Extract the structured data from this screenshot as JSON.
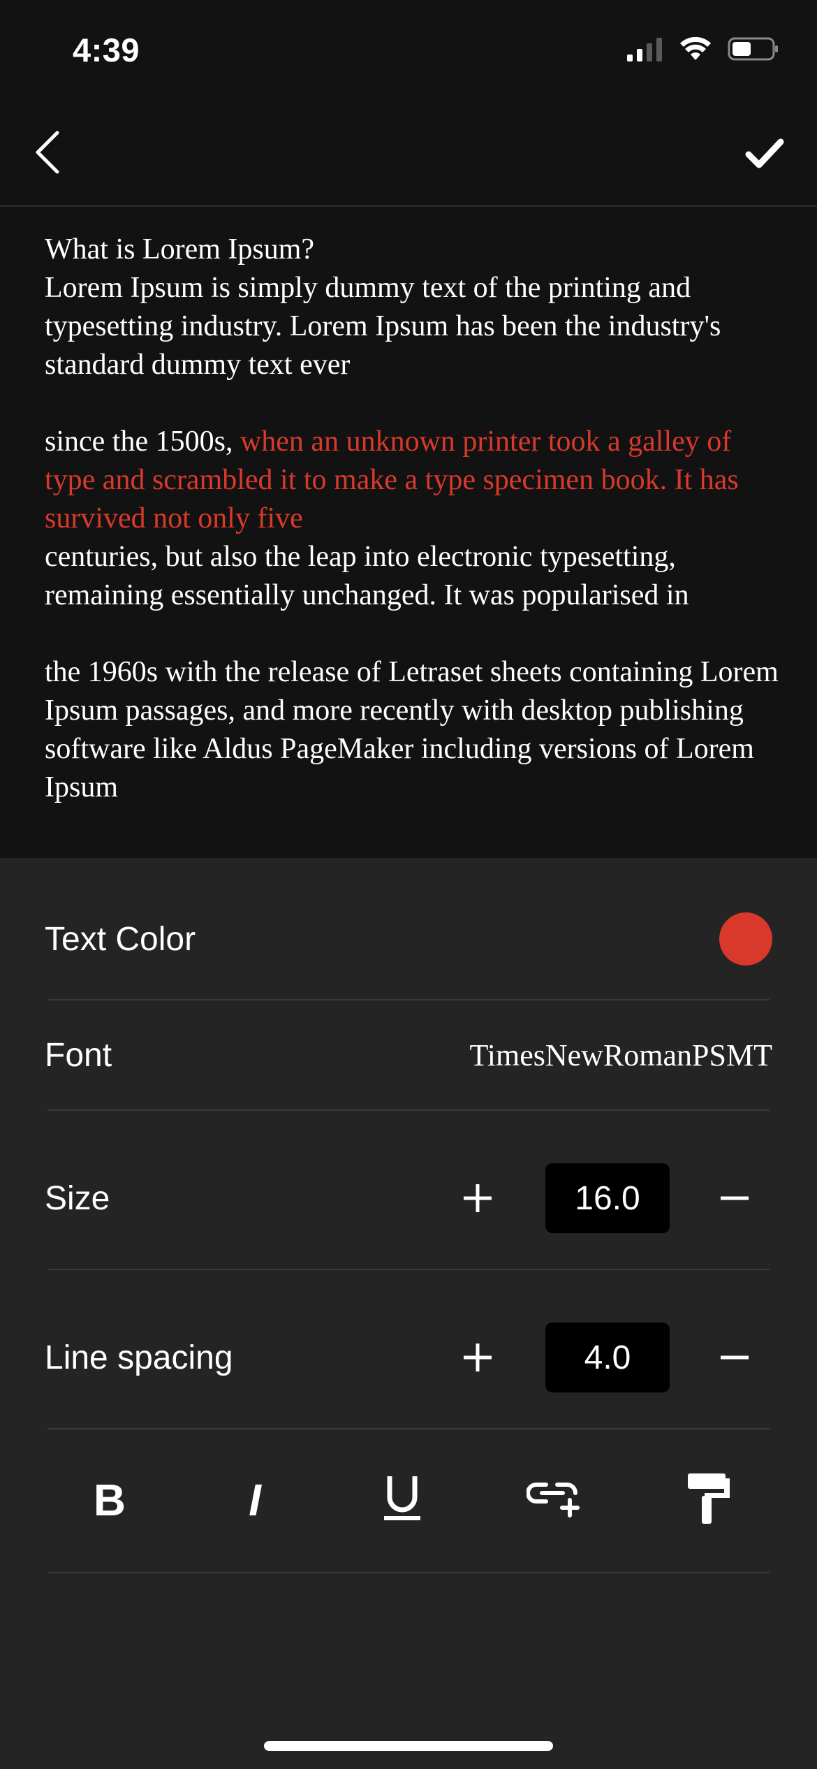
{
  "status_bar": {
    "time": "4:39"
  },
  "editor": {
    "paragraphs": [
      {
        "segments": [
          {
            "text": "What is Lorem Ipsum?\nLorem Ipsum is simply dummy text of the printing and typesetting industry. Lorem Ipsum has been the industry's standard dummy text ever",
            "color": "#ffffff"
          }
        ]
      },
      {
        "segments": [
          {
            "text": "since the 1500s, ",
            "color": "#ffffff"
          },
          {
            "text": "when an unknown printer took a galley of type and scrambled it to make a type specimen book. It has survived not only five",
            "color": "#d9392b"
          },
          {
            "text": "\ncenturies, but also the leap into electronic typesetting, remaining essentially unchanged. It was popularised in",
            "color": "#ffffff"
          }
        ]
      },
      {
        "segments": [
          {
            "text": " the 1960s with the release of Letraset sheets containing Lorem Ipsum passages, and more recently with desktop publishing software like Aldus PageMaker including versions of Lorem Ipsum",
            "color": "#ffffff"
          }
        ]
      }
    ]
  },
  "panel": {
    "text_color": {
      "label": "Text Color",
      "value": "#d9392b"
    },
    "font": {
      "label": "Font",
      "value": "TimesNewRomanPSMT"
    },
    "size": {
      "label": "Size",
      "value": "16.0"
    },
    "line_spacing": {
      "label": "Line spacing",
      "value": "4.0"
    }
  },
  "icons": {
    "back": "chevron-left-icon",
    "done": "checkmark-icon",
    "bold": "bold-icon",
    "italic": "italic-icon",
    "underline": "underline-icon",
    "link": "link-add-icon",
    "format_painter": "paint-roller-icon"
  },
  "colors": {
    "background": "#121212",
    "panel": "#242424",
    "accent": "#d9392b"
  }
}
